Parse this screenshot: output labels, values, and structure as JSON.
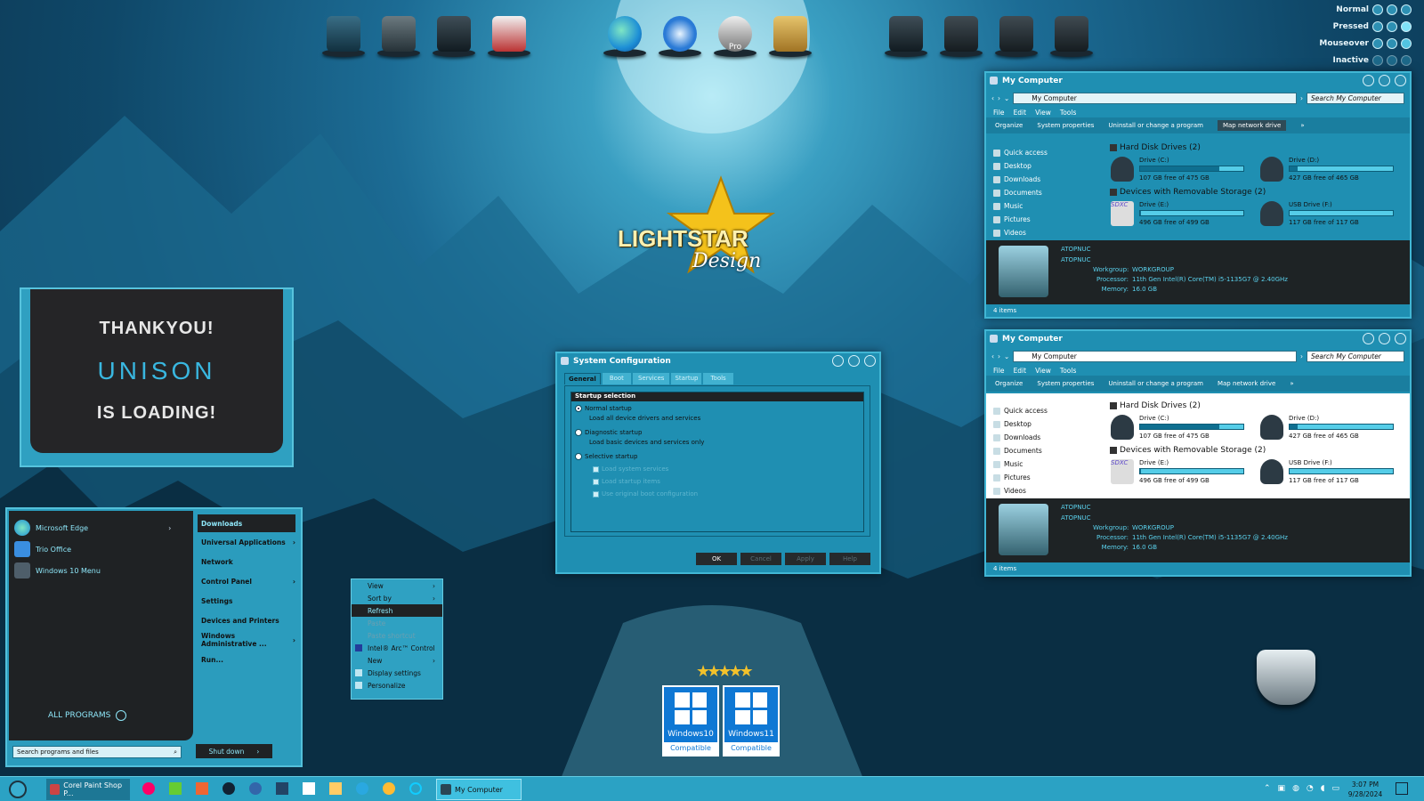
{
  "theme_states": {
    "normal": "Normal",
    "pressed": "Pressed",
    "mouseover": "Mouseover",
    "inactive": "Inactive"
  },
  "splash": {
    "line1": "THANKYOU!",
    "line2": "UNISON",
    "line3": "IS LOADING!"
  },
  "logo": {
    "text1": "LIGHTSTAR",
    "text2": "Design"
  },
  "dock": [
    "computer-icon",
    "notes-icon",
    "server-icon",
    "checklist-icon",
    "edge-icon",
    "thunderbird-icon",
    "pro-icon",
    "address-book-icon",
    "server-icon",
    "drive-icon",
    "drive-icon",
    "drive-icon"
  ],
  "dock_labels": {
    "pro": "Pro"
  },
  "explorer": {
    "title": "My Computer",
    "address": "My Computer",
    "search_placeholder": "Search My Computer",
    "menu": [
      "File",
      "Edit",
      "View",
      "Tools"
    ],
    "commands": [
      "Organize",
      "System properties",
      "Uninstall or change a program",
      "Map network drive",
      "»"
    ],
    "nav": [
      "Quick access",
      "Desktop",
      "Downloads",
      "Documents",
      "Music",
      "Pictures",
      "Videos"
    ],
    "group_hdd": "Hard Disk Drives (2)",
    "group_removable": "Devices with Removable Storage (2)",
    "drives": [
      {
        "name": "Drive (C:)",
        "free": "107 GB free of 475 GB",
        "used_pct": 77
      },
      {
        "name": "Drive (D:)",
        "free": "427 GB free of 465 GB",
        "used_pct": 8
      },
      {
        "name": "Drive (E:)",
        "free": "496 GB free of 499 GB",
        "used_pct": 1
      },
      {
        "name": "USB Drive (F:)",
        "free": "117 GB free of 117 GB",
        "used_pct": 0
      }
    ],
    "sdxc": "SDXC",
    "pc_name": "ATOPNUC",
    "pc_name2": "ATOPNUC",
    "workgroup_label": "Workgroup:",
    "workgroup": "WORKGROUP",
    "processor_label": "Processor:",
    "processor": "11th Gen Intel(R) Core(TM) i5-1135G7 @ 2.40GHz",
    "memory_label": "Memory:",
    "memory": "16.0 GB",
    "items": "4 items"
  },
  "msconfig": {
    "title": "System Configuration",
    "tabs": [
      "General",
      "Boot",
      "Services",
      "Startup",
      "Tools"
    ],
    "group": "Startup selection",
    "normal": "Normal startup",
    "normal_desc": "Load all device drivers and services",
    "diag": "Diagnostic startup",
    "diag_desc": "Load basic devices and services only",
    "selective": "Selective startup",
    "checks": [
      "Load system services",
      "Load startup items",
      "Use original boot configuration"
    ],
    "buttons": [
      "OK",
      "Cancel",
      "Apply",
      "Help"
    ]
  },
  "context_menu": {
    "items": [
      "View",
      "Sort by",
      "Refresh",
      "Paste",
      "Paste shortcut",
      "Intel® Arc™ Control",
      "New",
      "Display settings",
      "Personalize"
    ]
  },
  "start": {
    "pinned": [
      "Microsoft Edge",
      "Trio Office",
      "Windows 10 Menu"
    ],
    "right": [
      "Downloads",
      "Universal Applications",
      "Network",
      "Control Panel",
      "Settings",
      "Devices and Printers",
      "Windows Administrative ...",
      "Run..."
    ],
    "all_programs": "ALL PROGRAMS",
    "search": "Search programs and files",
    "shutdown": "Shut down"
  },
  "badges": {
    "w10": "Windows10",
    "w11": "Windows11",
    "compat": "Compatible"
  },
  "taskbar": {
    "app1": "Corel Paint Shop P...",
    "app2": "My Computer",
    "time": "3:07 PM",
    "date": "9/28/2024"
  }
}
